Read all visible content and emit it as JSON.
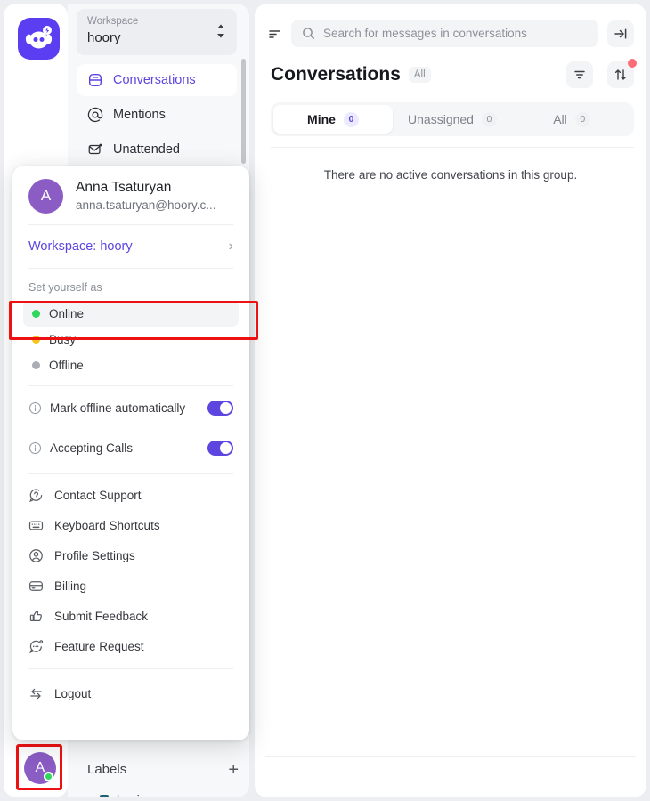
{
  "app": {
    "logo_icon": "hoory-pig-logo-icon",
    "brand_color": "#5b3df2"
  },
  "sidebar": {
    "workspace_switcher": {
      "label": "Workspace",
      "value": "hoory",
      "caret_icon": "chevron-updown-icon"
    },
    "nav_items": [
      {
        "label": "Conversations",
        "icon": "conversations-icon",
        "active": true
      },
      {
        "label": "Mentions",
        "icon": "at-mention-icon",
        "active": false
      },
      {
        "label": "Unattended",
        "icon": "envelope-unattended-icon",
        "active": false
      }
    ],
    "labels_section": {
      "title": "Labels",
      "add_icon": "plus-icon",
      "items": [
        {
          "name": "business",
          "color": "#1d5e72"
        }
      ]
    },
    "rail_avatar": {
      "initial": "A",
      "status_color": "#2fd75d",
      "highlighted": true
    }
  },
  "account_dropdown": {
    "user": {
      "initial": "A",
      "name": "Anna Tsaturyan",
      "email": "anna.tsaturyan@hoory.c...",
      "avatar_color": "#8a5cc4"
    },
    "workspace_link": {
      "label": "Workspace: hoory",
      "chevron_icon": "chevron-right-icon",
      "color": "#5b46e0"
    },
    "status_caption": "Set yourself as",
    "statuses": [
      {
        "label": "Online",
        "color": "#2fd75d",
        "selected": true
      },
      {
        "label": "Busy",
        "color": "#f5c518",
        "selected": false
      },
      {
        "label": "Offline",
        "color": "#a9adb4",
        "selected": false
      }
    ],
    "toggles": [
      {
        "label": "Mark offline automatically",
        "icon": "info-icon",
        "on": true,
        "highlighted": false
      },
      {
        "label": "Accepting Calls",
        "icon": "info-icon",
        "on": true,
        "highlighted": true
      }
    ],
    "menu_items": [
      {
        "label": "Contact Support",
        "icon": "help-chat-icon"
      },
      {
        "label": "Keyboard Shortcuts",
        "icon": "keyboard-icon"
      },
      {
        "label": "Profile Settings",
        "icon": "user-circle-icon"
      },
      {
        "label": "Billing",
        "icon": "credit-card-icon"
      },
      {
        "label": "Submit Feedback",
        "icon": "thumbs-up-icon"
      },
      {
        "label": "Feature Request",
        "icon": "chat-bubble-icon"
      }
    ],
    "logout": {
      "label": "Logout",
      "icon": "logout-arrows-icon"
    },
    "highlight_color": "#ee1111"
  },
  "main": {
    "toolbar": {
      "sort_lines_icon": "sort-lines-icon",
      "search_icon": "search-icon",
      "search_placeholder": "Search for messages in conversations",
      "collapse_icon": "collapse-panel-icon"
    },
    "header": {
      "title": "Conversations",
      "scope_badge": "All",
      "filter_icon": "filter-icon",
      "sort_icon": "sort-updown-icon",
      "notification_dot_color": "#fb6d77"
    },
    "tabs": [
      {
        "label": "Mine",
        "count": "0",
        "active": true
      },
      {
        "label": "Unassigned",
        "count": "0",
        "active": false
      },
      {
        "label": "All",
        "count": "0",
        "active": false
      }
    ],
    "empty_message": "There are no active conversations in this group."
  }
}
